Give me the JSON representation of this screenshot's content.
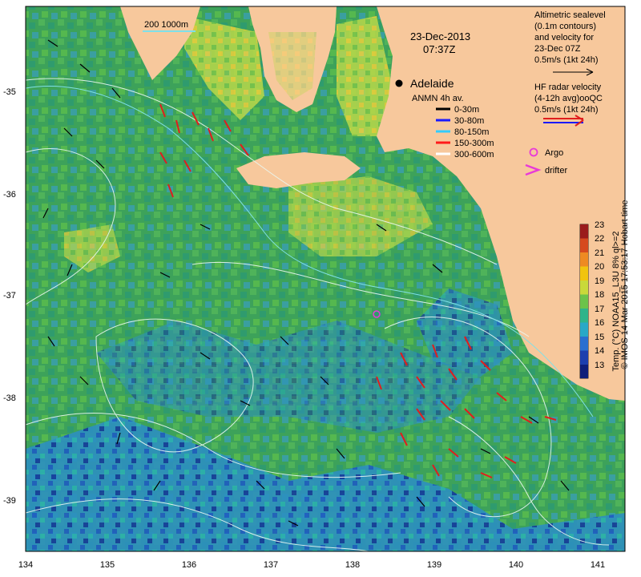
{
  "header": {
    "date": "23-Dec-2013",
    "time": "07:37Z",
    "scale_text": "200  1000m"
  },
  "places": {
    "city": "Adelaide"
  },
  "legend_left": {
    "title": "ANMN 4h av.",
    "items": [
      {
        "label": "0-30m",
        "color": "#000000"
      },
      {
        "label": "30-80m",
        "color": "#1a1aff"
      },
      {
        "label": "80-150m",
        "color": "#33ccff"
      },
      {
        "label": "150-300m",
        "color": "#ff1a1a"
      },
      {
        "label": "300-600m",
        "color": "#ffffff"
      }
    ]
  },
  "legend_right": {
    "altimetric": [
      "Altimetric sealevel",
      "(0.1m contours)",
      "and velocity for",
      "23-Dec 07Z",
      "0.5m/s (1kt 24h)"
    ],
    "hf_radar": [
      "HF radar velocity",
      "(4-12h avg)ooQC",
      "0.5m/s (1kt 24h)"
    ],
    "argo": "Argo",
    "drifter": "drifter"
  },
  "colorbar": {
    "ticks": [
      "23",
      "22",
      "21",
      "20",
      "19",
      "18",
      "17",
      "16",
      "15",
      "14",
      "13"
    ],
    "label": "Temp. (°C) NOAA15_L3U 8% ql>=2",
    "colors": [
      "#9b1c1c",
      "#d64a1e",
      "#ee8a22",
      "#f1c40f",
      "#c9d93a",
      "#6cc34a",
      "#2fb48a",
      "#29a8c7",
      "#2a6fd0",
      "#1c3fae",
      "#0e1f7a"
    ]
  },
  "axes": {
    "x_ticks": [
      "134",
      "135",
      "136",
      "137",
      "138",
      "139",
      "140",
      "141"
    ],
    "y_ticks": [
      "-35",
      "-36",
      "-37",
      "-38",
      "-39"
    ]
  },
  "credit": "© IMOS 14-Mar-2015 17:53:17 Hobart time",
  "colors": {
    "land": "#f7c89c",
    "ocean_base": "#3aa56a"
  }
}
